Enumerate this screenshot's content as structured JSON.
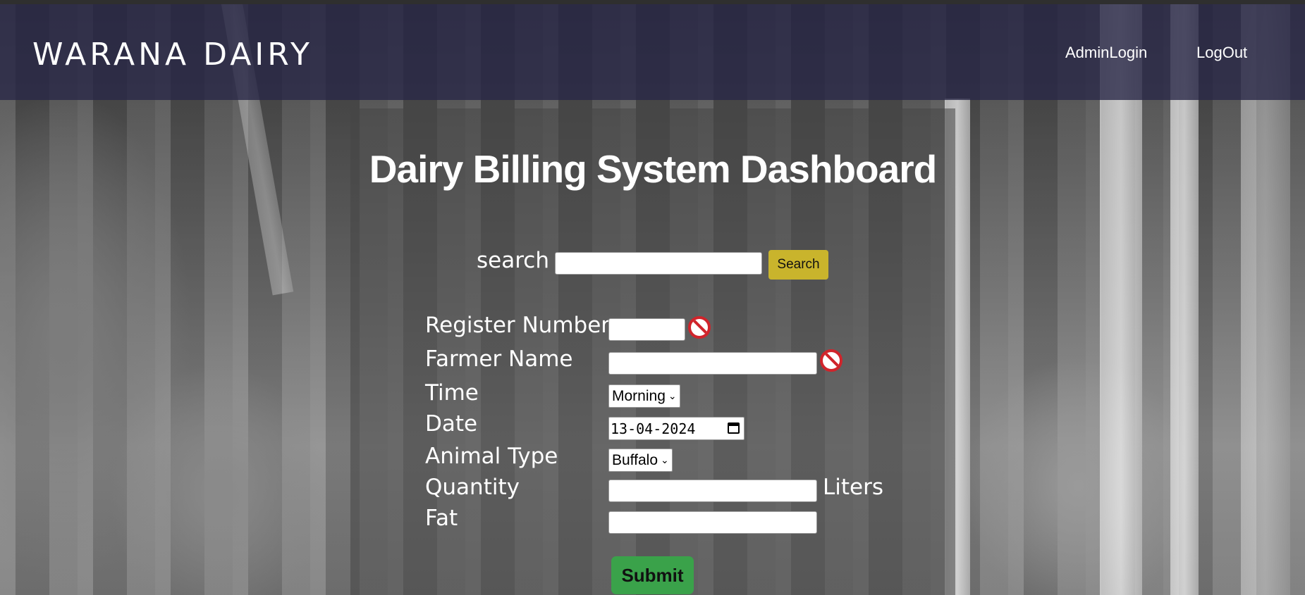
{
  "header": {
    "brand": "WARANA DAIRY",
    "nav": [
      {
        "label": "AdminLogin"
      },
      {
        "label": "LogOut"
      }
    ]
  },
  "main": {
    "title": "Dairy Billing System Dashboard",
    "search": {
      "label": "search",
      "value": "",
      "button_label": "Search"
    },
    "form": {
      "register_number": {
        "label": "Register Number",
        "value": ""
      },
      "farmer_name": {
        "label": "Farmer Name",
        "value": ""
      },
      "time": {
        "label": "Time",
        "selected": "Morning"
      },
      "date": {
        "label": "Date",
        "value": "13-04-2024"
      },
      "animal_type": {
        "label": "Animal Type",
        "selected": "Buffalo"
      },
      "quantity": {
        "label": "Quantity",
        "value": "",
        "unit": "Liters"
      },
      "fat": {
        "label": "Fat",
        "value": ""
      },
      "submit_label": "Submit"
    }
  },
  "icons": {
    "invalid": "no-entry-icon",
    "select": "chevron-down-icon",
    "date": "calendar-icon"
  },
  "colors": {
    "header_bg": "#28264a",
    "search_button": "#c9b42c",
    "submit_button": "#3aa24a",
    "invalid_icon": "#d0242b"
  }
}
